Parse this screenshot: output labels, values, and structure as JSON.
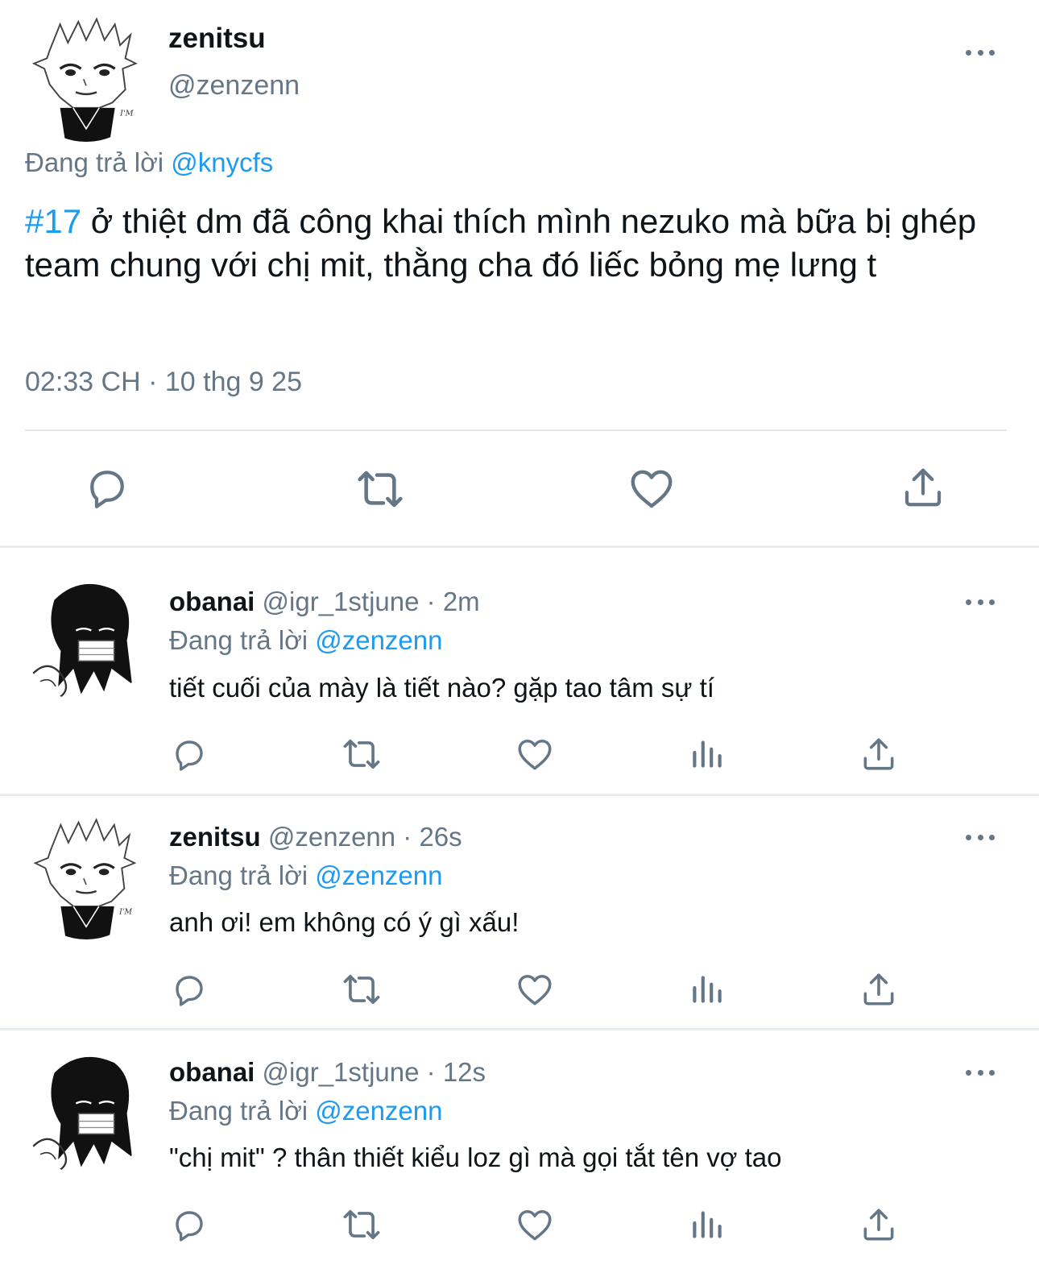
{
  "main_tweet": {
    "display_name": "zenitsu",
    "handle": "@zenzenn",
    "reply_prefix": "Đang trả lời",
    "reply_to": "@knycfs",
    "hashtag": "#17",
    "text": " ở thiệt dm đã công khai thích mình nezuko mà bữa bị ghép team chung với chị mit, thằng cha đó liếc bỏng mẹ lưng t",
    "timestamp": "02:33 CH · 10 thg 9 25"
  },
  "replies": [
    {
      "display_name": "obanai",
      "handle": "@igr_1stjune",
      "time": "· 2m",
      "reply_prefix": "Đang trả lời",
      "reply_to": "@zenzenn",
      "text": "tiết cuối của mày là tiết nào? gặp tao tâm sự tí"
    },
    {
      "display_name": "zenitsu",
      "handle": "@zenzenn",
      "time": "· 26s",
      "reply_prefix": "Đang trả lời",
      "reply_to": "@zenzenn",
      "text": "anh ơi! em không có ý gì xấu!"
    },
    {
      "display_name": "obanai",
      "handle": "@igr_1stjune",
      "time": "· 12s",
      "reply_prefix": "Đang trả lời",
      "reply_to": "@zenzenn",
      "text": "\"chị mit\" ? thân thiết kiểu loz gì mà gọi tắt tên vợ tao"
    }
  ],
  "icons": [
    "more-icon",
    "reply-icon",
    "retweet-icon",
    "like-icon",
    "views-icon",
    "share-icon"
  ],
  "colors": {
    "link": "#1d9bf0",
    "muted": "#657786",
    "text": "#0f1419",
    "divider": "#e8ecef"
  }
}
